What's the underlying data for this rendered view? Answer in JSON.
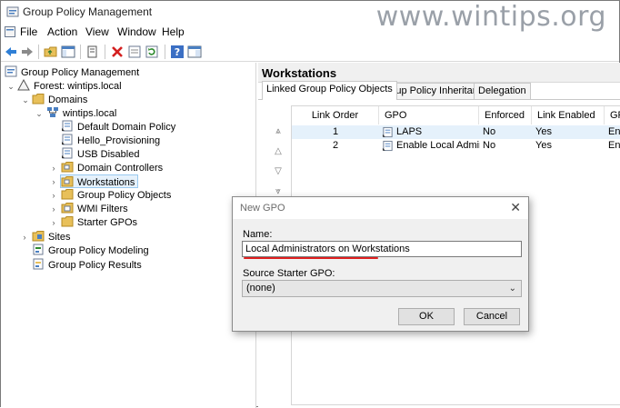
{
  "window": {
    "title": "Group Policy Management",
    "watermark": "www.wintips.org"
  },
  "menubar": {
    "items": [
      "File",
      "Action",
      "View",
      "Window",
      "Help"
    ]
  },
  "toolbar": {
    "icons": [
      "back-arrow-icon",
      "forward-arrow-icon",
      "up-folder-icon",
      "show-hide-console-tree-icon",
      "copy-icon",
      "delete-icon",
      "properties-icon",
      "refresh-icon",
      "help-icon",
      "console-icon"
    ]
  },
  "tree": {
    "root": "Group Policy Management",
    "forest": "Forest: wintips.local",
    "domains": "Domains",
    "domain": "wintips.local",
    "items": [
      "Default Domain Policy",
      "Hello_Provisioning",
      "USB Disabled",
      "Domain Controllers",
      "Workstations",
      "Group Policy Objects",
      "WMI Filters",
      "Starter GPOs"
    ],
    "sites": "Sites",
    "modeling": "Group Policy Modeling",
    "results": "Group Policy Results"
  },
  "right_pane": {
    "title": "Workstations",
    "tabs": [
      "Linked Group Policy Objects",
      "Group Policy Inheritance",
      "Delegation"
    ],
    "columns": [
      "Link Order",
      "GPO",
      "Enforced",
      "Link Enabled",
      "GP"
    ],
    "rows": [
      {
        "order": "1",
        "gpo": "LAPS",
        "enforced": "No",
        "enabled": "Yes",
        "status": "Ena"
      },
      {
        "order": "2",
        "gpo": "Enable Local Admini...",
        "enforced": "No",
        "enabled": "Yes",
        "status": "Ena"
      }
    ]
  },
  "dialog": {
    "title": "New GPO",
    "close": "✕",
    "name_label": "Name:",
    "name_value": "Local Administrators on Workstations",
    "starter_label": "Source Starter GPO:",
    "starter_value": "(none)",
    "ok": "OK",
    "cancel": "Cancel"
  },
  "colors": {
    "selection": "#e5f1fb",
    "accent_red": "#e02020"
  }
}
